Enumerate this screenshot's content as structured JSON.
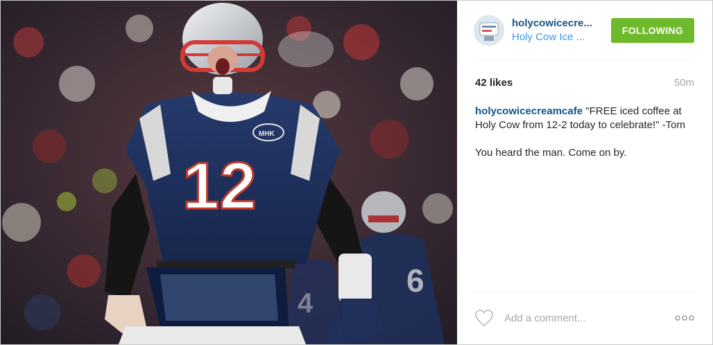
{
  "post": {
    "image_alt": "Football player in number 12 jersey celebrating",
    "jersey_number": "12"
  },
  "header": {
    "username": "holycowicecre...",
    "location": "Holy Cow Ice ...",
    "follow_label": "FOLLOWING",
    "avatar_icon": "shop-logo-icon"
  },
  "stats": {
    "likes": "42 likes",
    "time_ago": "50m"
  },
  "caption": {
    "author": "holycowicecreamcafe",
    "text": "\"FREE iced coffee at Holy Cow from 12-2 today to celebrate!\" -Tom",
    "second_line": "You heard the man. Come on by."
  },
  "footer": {
    "comment_placeholder": "Add a comment...",
    "like_icon": "heart-icon",
    "more_icon": "more-options-icon"
  },
  "colors": {
    "follow_button": "#6fba2c",
    "username": "#125688",
    "location": "#3897f0",
    "muted": "#a5a7aa"
  }
}
